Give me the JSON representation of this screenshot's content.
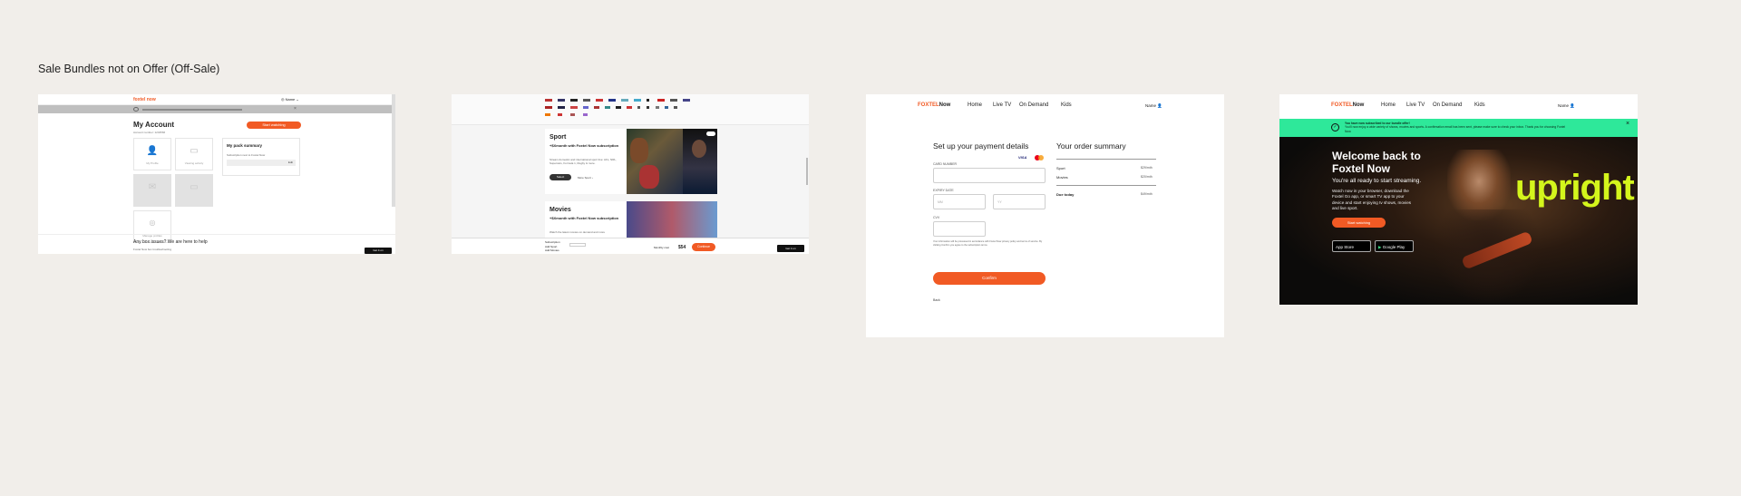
{
  "board": {
    "title": "Sale Bundles not on Offer (Off-Sale)"
  },
  "screen1": {
    "brand": "foxtel now",
    "user_menu": "Name",
    "page_title": "My Account",
    "account_number": "Account number: 1234566",
    "cta": "Start watching",
    "tiles": [
      "My Profile",
      "Viewing activity",
      "",
      "",
      "Manage profiles"
    ],
    "pack_summary_title": "My pack summary",
    "pack_summary_desc": "Subscription next to Foxtel Now",
    "pack_summary_link": "Edit",
    "help_title": "Any box issues? We are here to help",
    "help_link": "Foxtel Now box troubleshooting",
    "store_badge": "Get it on"
  },
  "screen2": {
    "sport_title": "Sport",
    "sport_desc": "+$Xmonth with Foxtel Now subscription",
    "sport_body": "Stream domestic and international sport live: AFL, NRL, Supercars, Formula 1, Rugby & more.",
    "sport_btn": "Select",
    "sport_more": "More Sport",
    "movies_title": "Movies",
    "movies_desc": "+$Xmonth with Foxtel Now subscription",
    "movies_body": "Watch the latest movies on demand and more",
    "footer_labels": [
      "Subscription",
      "Add Sport",
      "Add Movies"
    ],
    "footer_total_label": "Monthly cost",
    "footer_price": "$54",
    "footer_btn": "Continue",
    "store_badge": "Get it on"
  },
  "screen3": {
    "brand_a": "FOXTEL",
    "brand_b": "Now",
    "nav": [
      "Home",
      "Live TV",
      "On Demand",
      "Kids"
    ],
    "user": "Name",
    "payment_title": "Set up your payment details",
    "card_label": "CARD NUMBER",
    "expiry_label": "EXPIRY DATE",
    "mm": "MM",
    "yy": "YY",
    "cvv_label": "CVV",
    "legal": "Your information will be processed in accordance with Foxtel Now privacy policy and terms of service. By clicking Confirm you agree to the subscription terms.",
    "card_brand": "VISA",
    "cta": "Confirm",
    "back": "Back",
    "order_title": "Your order summary",
    "items": [
      {
        "name": "Sport",
        "price": "$29/mth"
      },
      {
        "name": "Movies",
        "price": "$20/mth"
      }
    ],
    "due_label": "Due today",
    "due_price": "$49/mth"
  },
  "screen4": {
    "brand_a": "FOXTEL",
    "brand_b": "Now",
    "nav": [
      "Home",
      "Live TV",
      "On Demand",
      "Kids"
    ],
    "user": "Name",
    "notice_l1": "You have now subscribed to our bundle offer!",
    "notice_l2": "You'll now enjoy a wide variety of shows, movies and sports. A confirmation email has been sent, please make sure to check your inbox. Thank you for choosing Foxtel Now.",
    "welcome_l1": "Welcome back to",
    "welcome_l2": "Foxtel Now",
    "subtitle": "You're all ready to start streaming.",
    "body": "Watch now in your browser, download the Foxtel Go app, or smart TV app to your device and start enjoying tv shows, movies and live sport.",
    "cta": "Start watching",
    "app_store": "App Store",
    "google_play": "Google Play",
    "show_logo": "upright",
    "colors": {
      "accent": "#f15a24",
      "notice": "#2ee89a",
      "logo": "#d4f51c"
    }
  }
}
